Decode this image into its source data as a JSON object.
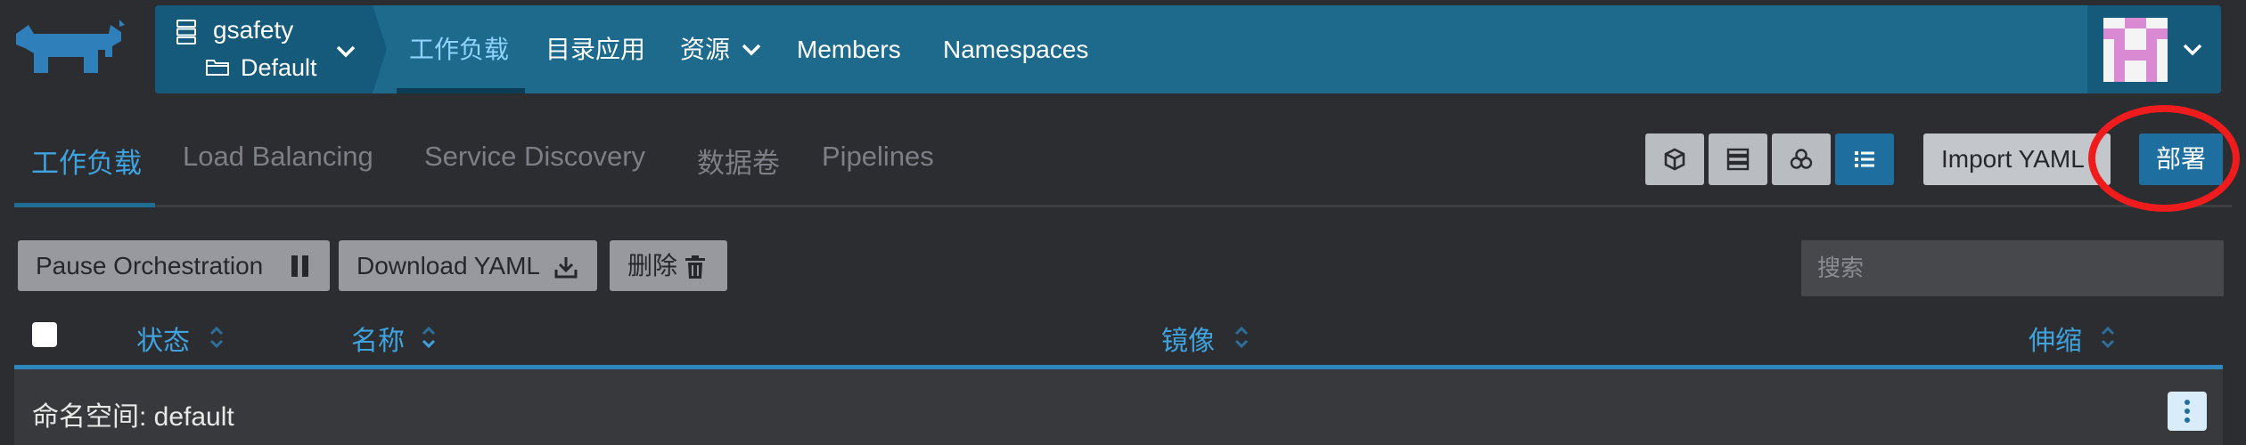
{
  "header": {
    "cluster_name": "gsafety",
    "project_name": "Default",
    "nav": [
      {
        "label": "工作负载",
        "active": true
      },
      {
        "label": "目录应用",
        "active": false
      },
      {
        "label": "资源",
        "active": false,
        "dropdown": true
      },
      {
        "label": "Members",
        "active": false
      },
      {
        "label": "Namespaces",
        "active": false
      }
    ],
    "colors": {
      "bar": "#1e6a8d",
      "bar_dark": "#155a7b",
      "active_nav": "#8fd3ff"
    }
  },
  "tabs": [
    {
      "label": "工作负载",
      "active": true
    },
    {
      "label": "Load Balancing",
      "active": false
    },
    {
      "label": "Service Discovery",
      "active": false
    },
    {
      "label": "数据卷",
      "active": false
    },
    {
      "label": "Pipelines",
      "active": false
    }
  ],
  "view_toggles": [
    {
      "icon": "cube-icon",
      "active": false
    },
    {
      "icon": "server-stack-icon",
      "active": false
    },
    {
      "icon": "cluster-nodes-icon",
      "active": false
    },
    {
      "icon": "list-icon",
      "active": true
    }
  ],
  "actions": {
    "import_yaml": "Import YAML",
    "deploy": "部署",
    "pause": "Pause Orchestration",
    "download": "Download YAML",
    "delete": "删除"
  },
  "search": {
    "placeholder": "搜索",
    "value": ""
  },
  "table": {
    "columns": [
      "状态",
      "名称",
      "镜像",
      "伸缩"
    ],
    "group_label": "命名空间: default"
  },
  "annotation": {
    "highlight_color": "#ee1c1c",
    "target": "deploy-button"
  }
}
